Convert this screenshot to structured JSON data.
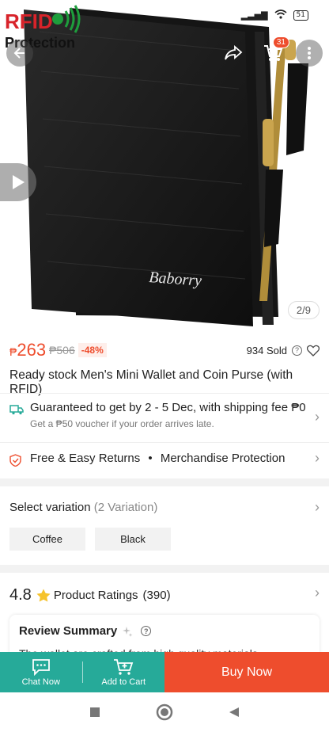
{
  "statusbar": {
    "battery": "51"
  },
  "hero": {
    "overlay_line1": "RFID",
    "overlay_line2": "Protection",
    "brand_on_product": "Baborry",
    "cart_count": "31",
    "image_counter": "2/9"
  },
  "price": {
    "currency": "₱",
    "current": "263",
    "original": "₱506",
    "discount": "-48%",
    "sold": "934 Sold"
  },
  "product_title": "Ready stock Men's Mini Wallet and Coin Purse (with RFID)",
  "shipping": {
    "main": "Guaranteed to get by 2 - 5 Dec, with shipping fee ₱0",
    "sub": "Get a ₱50 voucher if your order arrives late."
  },
  "returns": {
    "left": "Free & Easy Returns",
    "sep": "•",
    "right": "Merchandise Protection"
  },
  "variation": {
    "title": "Select variation",
    "count": "(2 Variation)",
    "options": [
      "Coffee",
      "Black"
    ]
  },
  "ratings": {
    "score": "4.8",
    "label": "Product Ratings",
    "count": "(390)"
  },
  "review": {
    "title": "Review Summary",
    "text": "The wallet are crafted from high quality materials"
  },
  "bottombar": {
    "chat": "Chat Now",
    "add_cart": "Add to Cart",
    "buy": "Buy Now"
  },
  "colors": {
    "accent": "#ee4d2d",
    "teal": "#26aa99"
  },
  "icons": [
    "back-icon",
    "share-icon",
    "cart-icon",
    "more-icon",
    "play-icon",
    "truck-icon",
    "shield-icon",
    "star-icon",
    "chat-icon",
    "add-cart-icon",
    "nav-square-icon",
    "nav-circle-icon",
    "nav-back-icon"
  ]
}
